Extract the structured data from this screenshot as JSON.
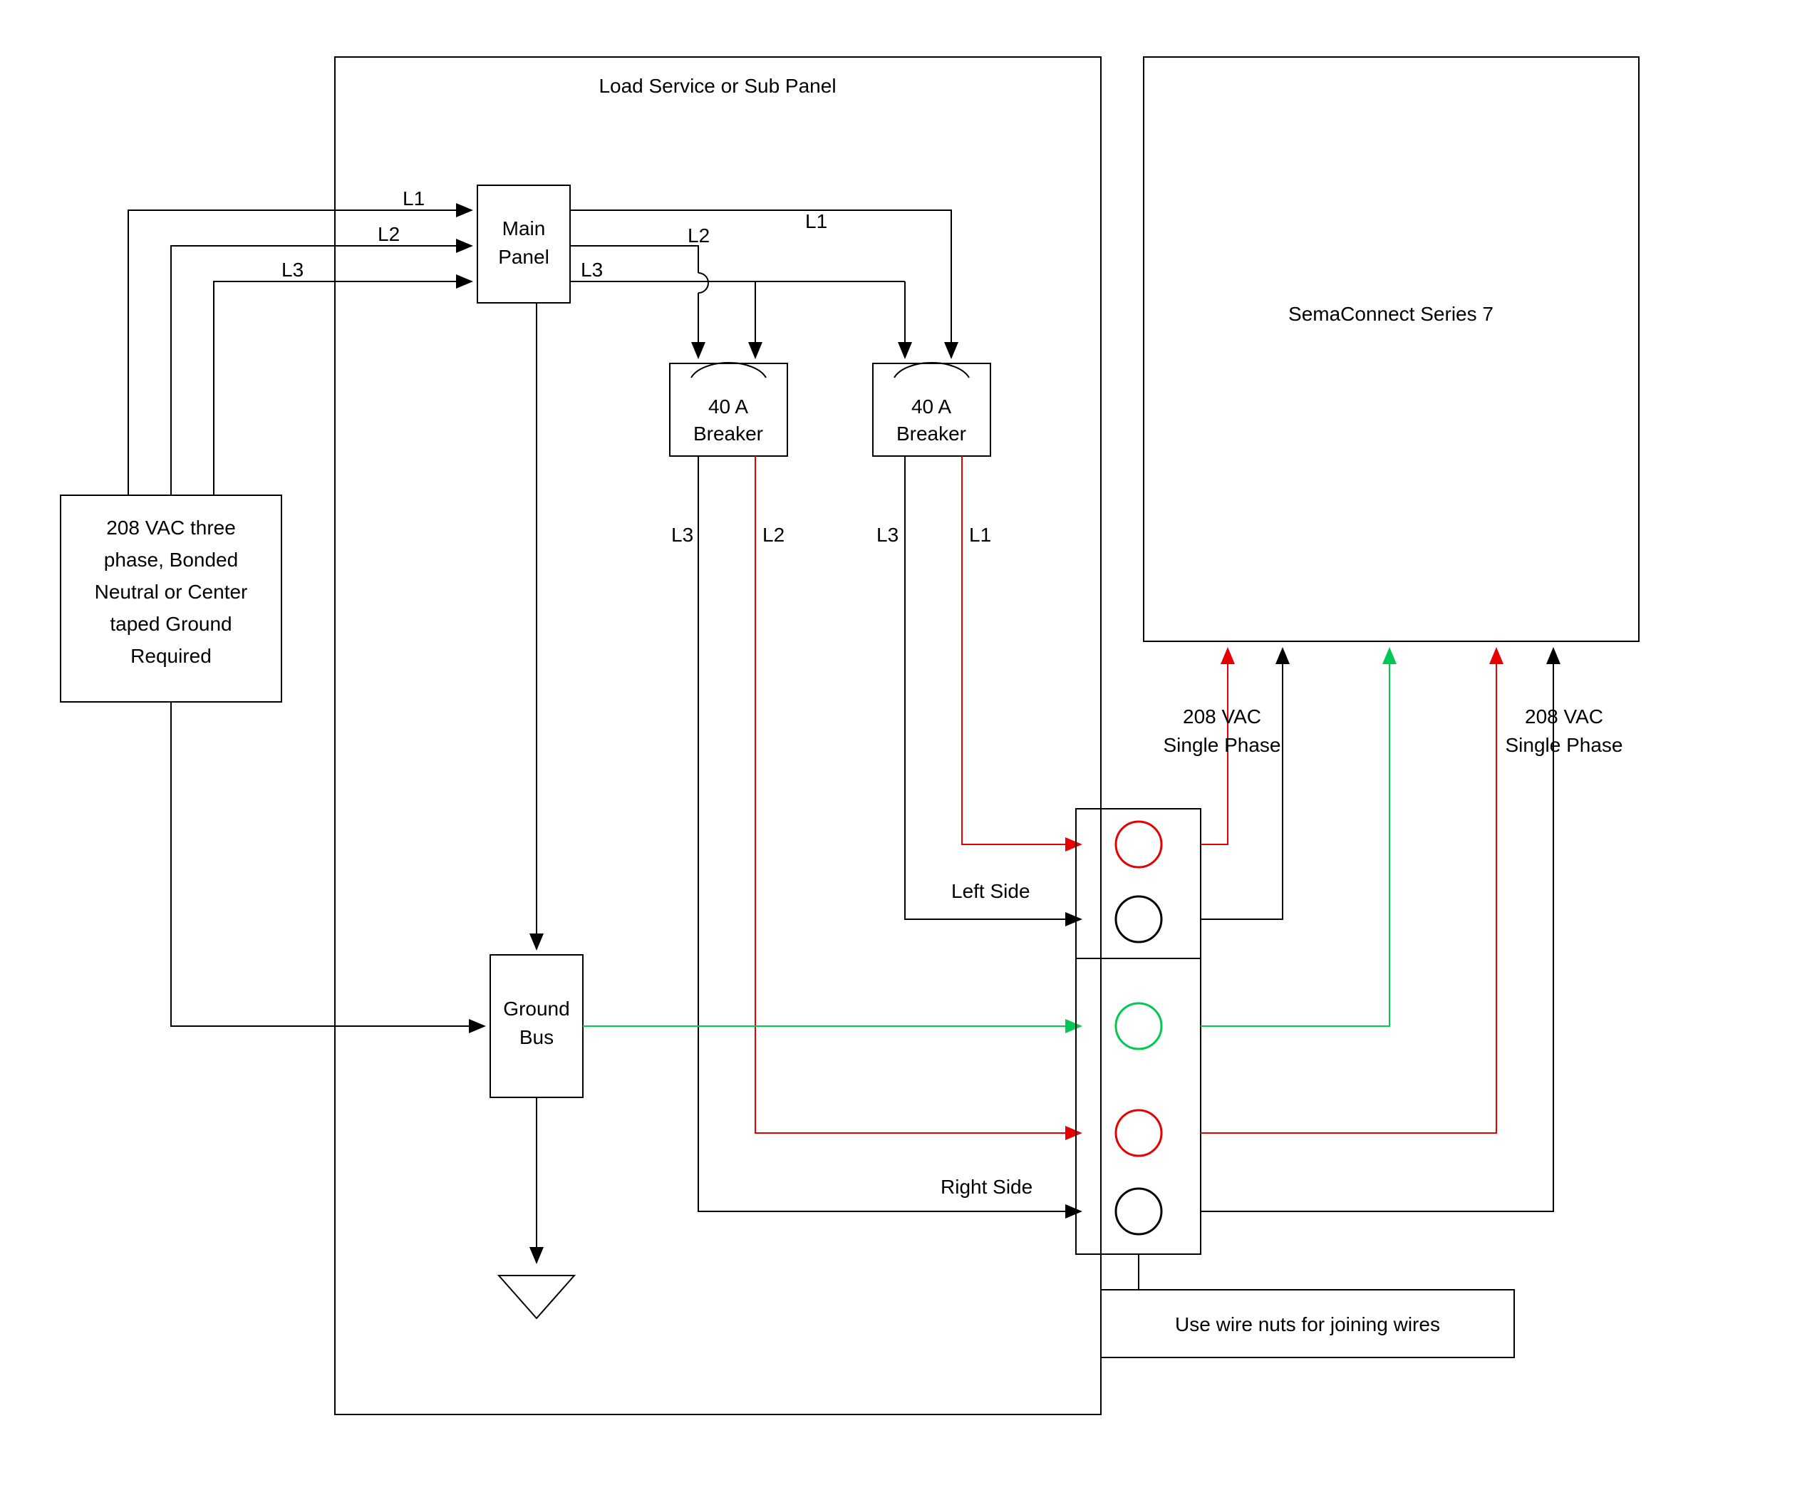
{
  "panel_title": "Load Service or Sub Panel",
  "source_box": {
    "line1": "208 VAC three",
    "line2": "phase, Bonded",
    "line3": "Neutral or Center",
    "line4": "taped Ground",
    "line5": "Required"
  },
  "main_panel": {
    "line1": "Main",
    "line2": "Panel"
  },
  "breaker_left": {
    "line1": "40 A",
    "line2": "Breaker"
  },
  "breaker_right": {
    "line1": "40 A",
    "line2": "Breaker"
  },
  "ground_bus": {
    "line1": "Ground",
    "line2": "Bus"
  },
  "charger_box": "SemaConnect Series 7",
  "wire_nuts_note": "Use wire nuts for joining wires",
  "phase_labels": {
    "L1": "L1",
    "L2": "L2",
    "L3": "L3"
  },
  "sides": {
    "left": "Left Side",
    "right": "Right Side"
  },
  "voltage_label": {
    "line1": "208 VAC",
    "line2": "Single Phase"
  },
  "colors": {
    "red": "#e60000",
    "green": "#00c853",
    "black": "#000000"
  }
}
